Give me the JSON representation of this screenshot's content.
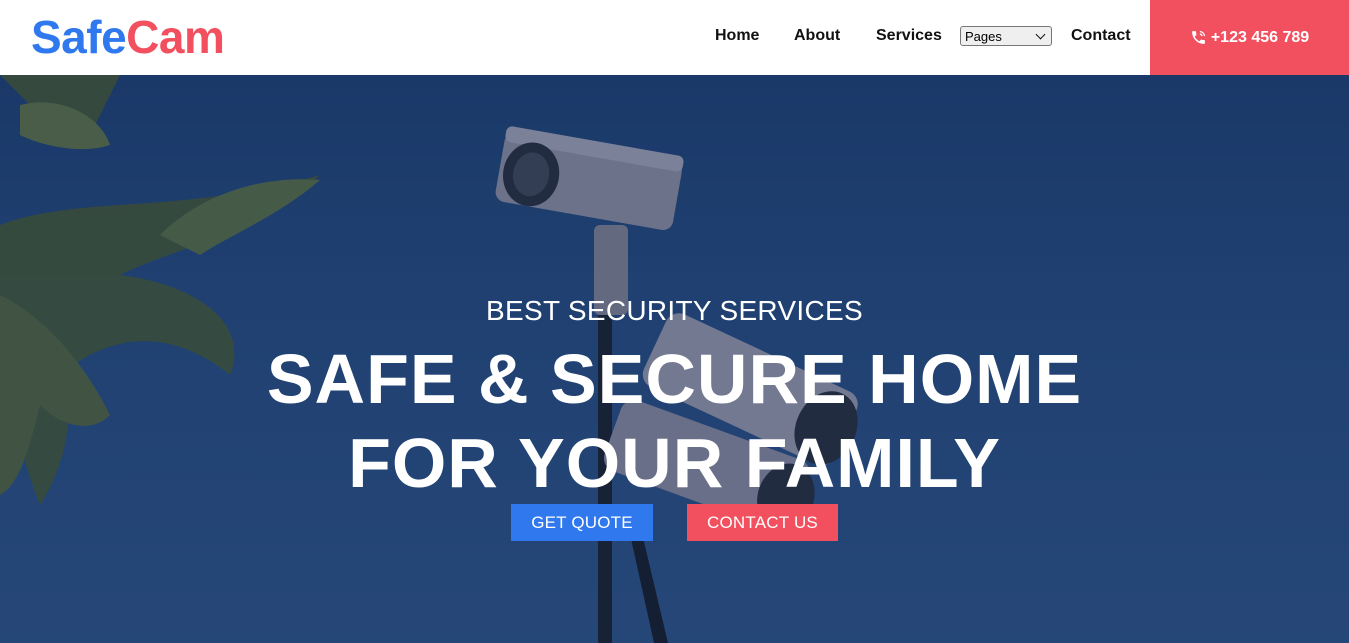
{
  "brand": {
    "part1": "Safe",
    "part2": "Cam",
    "color1": "#2f78ee",
    "color2": "#f2505f"
  },
  "nav": {
    "home": "Home",
    "about": "About",
    "services": "Services",
    "pages_selected": "Pages",
    "contact": "Contact"
  },
  "phone": {
    "number": "+123 456 789",
    "icon": "phone-icon"
  },
  "hero": {
    "kicker": "BEST SECURITY SERVICES",
    "line1": "SAFE & SECURE HOME",
    "line2": "FOR YOUR FAMILY",
    "quote_button": "GET QUOTE",
    "contact_button": "CONTACT US"
  }
}
